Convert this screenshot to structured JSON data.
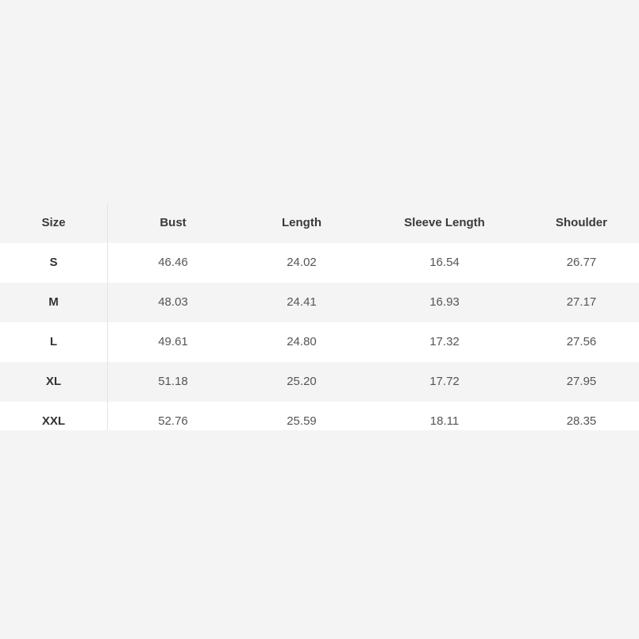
{
  "table": {
    "headers": [
      "Size",
      "Bust",
      "Length",
      "Sleeve Length",
      "Shoulder"
    ],
    "rows": [
      [
        "S",
        "46.46",
        "24.02",
        "16.54",
        "26.77"
      ],
      [
        "M",
        "48.03",
        "24.41",
        "16.93",
        "27.17"
      ],
      [
        "L",
        "49.61",
        "24.80",
        "17.32",
        "27.56"
      ],
      [
        "XL",
        "51.18",
        "25.20",
        "17.72",
        "27.95"
      ],
      [
        "XXL",
        "52.76",
        "25.59",
        "18.11",
        "28.35"
      ]
    ]
  },
  "colors": {
    "page_background": "#f4f4f4",
    "row_white": "#ffffff",
    "text": "#3a3a3a"
  }
}
